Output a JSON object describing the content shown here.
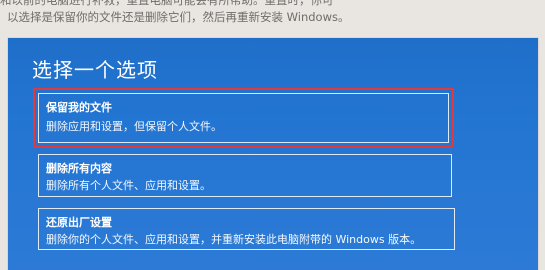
{
  "background": {
    "line1": "和以前的电脑进行补救，重置电脑可能会有所帮助。重置时，你可",
    "line2": "以选择是保留你的文件还是删除它们，然后再重新安装 Windows。"
  },
  "dialog": {
    "title": "选择一个选项",
    "options": [
      {
        "title": "保留我的文件",
        "description": "删除应用和设置，但保留个人文件。"
      },
      {
        "title": "删除所有内容",
        "description": "删除所有个人文件、应用和设置。"
      },
      {
        "title": "还原出厂设置",
        "description": "删除你的个人文件、应用和设置，并重新安装此电脑附带的 Windows 版本。"
      }
    ]
  },
  "colors": {
    "dialog_bg": "#2375d2",
    "highlight": "#e23a3a",
    "text": "#ffffff"
  }
}
